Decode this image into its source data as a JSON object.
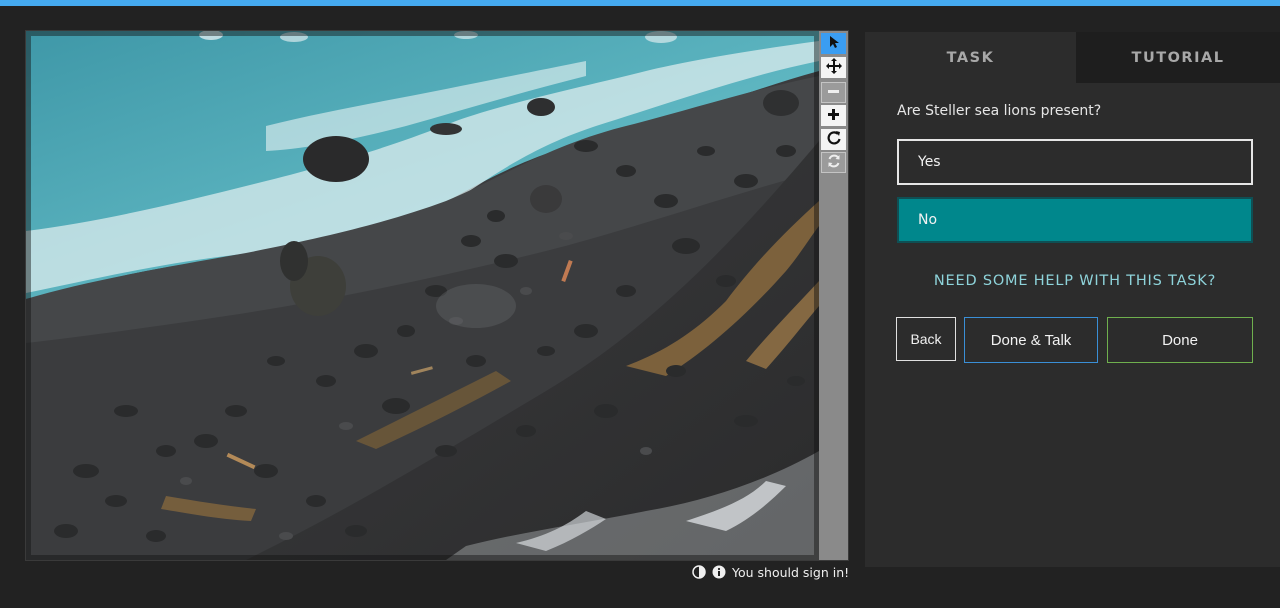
{
  "theme": {
    "accent": "#45aaf0",
    "answer_selected": "#00878c",
    "help_link": "#8ed3da"
  },
  "viewer": {
    "photo_description_icon": "photo-icon",
    "tools": [
      {
        "name": "pointer-tool",
        "icon": "cursor-arrow-icon",
        "glyph": "➤",
        "state": "active"
      },
      {
        "name": "move-tool",
        "icon": "move-arrows-icon",
        "glyph": "✥",
        "state": "normal"
      },
      {
        "name": "zoom-out-tool",
        "icon": "minus-icon",
        "glyph": "−",
        "state": "disabled"
      },
      {
        "name": "zoom-in-tool",
        "icon": "plus-icon",
        "glyph": "+",
        "state": "normal"
      },
      {
        "name": "rotate-tool",
        "icon": "rotate-icon",
        "glyph": "↻",
        "state": "normal"
      },
      {
        "name": "reset-tool",
        "icon": "refresh-icon",
        "glyph": "⟳",
        "state": "disabled"
      }
    ]
  },
  "status": {
    "text": "You should sign in!",
    "contrast_icon": "contrast-icon",
    "info_icon": "info-icon"
  },
  "tabs": {
    "task": "TASK",
    "tutorial": "TUTORIAL"
  },
  "task": {
    "question": "Are Steller sea lions present?",
    "answers": {
      "yes": "Yes",
      "no": "No"
    },
    "selected": "No",
    "help": "NEED SOME HELP WITH THIS TASK?"
  },
  "buttons": {
    "back": "Back",
    "done_talk": "Done & Talk",
    "done": "Done"
  }
}
